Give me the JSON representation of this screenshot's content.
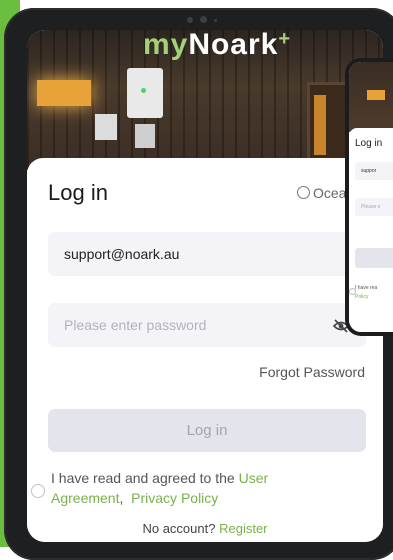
{
  "brand": {
    "my": "my",
    "noark": "Noark",
    "plus": "+"
  },
  "login": {
    "title": "Log in",
    "region_label": "Ocea",
    "email_value": "support@noark.au",
    "password_placeholder": "Please enter password",
    "forgot_password": "Forgot Password",
    "login_button": "Log in",
    "agree_prefix": "I have read and agreed to the ",
    "user_agreement": "User Agreement",
    "comma": ",",
    "privacy_policy": "Privacy Policy",
    "no_account": "No account?",
    "register": "Register"
  },
  "phone": {
    "title": "Log in",
    "email_value": "suppor",
    "password_placeholder": "Please e",
    "agree_text": "I have rea",
    "policy": "Policy"
  },
  "colors": {
    "accent_green": "#78b14a",
    "side_green": "#6cbf3e",
    "frame": "#1d1f21"
  }
}
